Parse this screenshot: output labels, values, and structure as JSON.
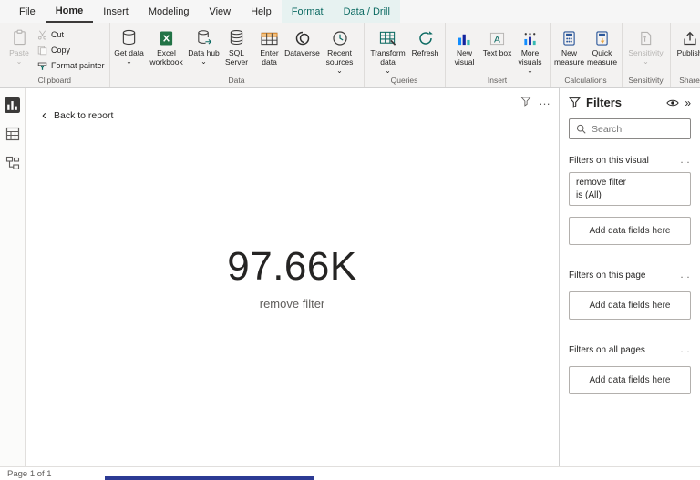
{
  "icons": {
    "chevron_down": "⌄",
    "ellipsis": "…",
    "back_chevron": "‹",
    "collapse_chevrons": "»"
  },
  "tabs": {
    "file": "File",
    "home": "Home",
    "insert": "Insert",
    "modeling": "Modeling",
    "view": "View",
    "help": "Help",
    "format": "Format",
    "data_drill": "Data / Drill"
  },
  "ribbon": {
    "clipboard": {
      "group_label": "Clipboard",
      "paste": "Paste",
      "cut": "Cut",
      "copy": "Copy",
      "format_painter": "Format painter"
    },
    "data": {
      "group_label": "Data",
      "get_data": "Get data",
      "excel_workbook": "Excel workbook",
      "data_hub": "Data hub",
      "sql_server": "SQL Server",
      "enter_data": "Enter data",
      "dataverse": "Dataverse",
      "recent_sources": "Recent sources"
    },
    "queries": {
      "group_label": "Queries",
      "transform_data": "Transform data",
      "refresh": "Refresh"
    },
    "insert": {
      "group_label": "Insert",
      "new_visual": "New visual",
      "text_box": "Text box",
      "more_visuals": "More visuals"
    },
    "calculations": {
      "group_label": "Calculations",
      "new_measure": "New measure",
      "quick_measure": "Quick measure"
    },
    "sensitivity_group": {
      "group_label": "Sensitivity",
      "sensitivity": "Sensitivity"
    },
    "share": {
      "group_label": "Share",
      "publish": "Publish"
    }
  },
  "canvas": {
    "back_link": "Back to report",
    "card": {
      "value": "97.66K",
      "label": "remove filter"
    }
  },
  "filters_pane": {
    "title": "Filters",
    "search_placeholder": "Search",
    "sections": {
      "visual": {
        "title": "Filters on this visual",
        "card_field": "remove filter",
        "card_condition": "is (All)",
        "add_fields": "Add data fields here"
      },
      "page": {
        "title": "Filters on this page",
        "add_fields": "Add data fields here"
      },
      "all_pages": {
        "title": "Filters on all pages",
        "add_fields": "Add data fields here"
      }
    }
  },
  "status_bar": {
    "page_indicator": "Page 1 of 1"
  },
  "colors": {
    "accent_teal": "#0b6a62",
    "excel_green": "#217346",
    "measure_blue": "#2b579a"
  }
}
